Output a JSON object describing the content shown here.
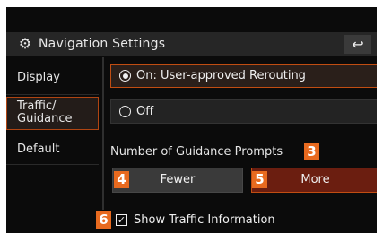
{
  "header": {
    "gear_icon": "gear-icon",
    "title": "Navigation Settings",
    "back_icon": "back-arrow-icon",
    "back_glyph": "↩"
  },
  "sidebar": {
    "items": [
      {
        "label": "Display",
        "active": false
      },
      {
        "label": "Traffic/\nGuidance",
        "active": true
      },
      {
        "label": "Default",
        "active": false
      }
    ]
  },
  "main": {
    "options": [
      {
        "label": "On: User-approved Rerouting",
        "selected": true
      },
      {
        "label": "Off",
        "selected": false
      }
    ],
    "prompts_label": "Number of Guidance Prompts",
    "buttons": {
      "fewer": "Fewer",
      "more": "More"
    },
    "show_traffic": {
      "label": "Show Traffic Information",
      "checked": true
    }
  },
  "callouts": {
    "three": "3",
    "four": "4",
    "five": "5",
    "six": "6"
  },
  "colors": {
    "accent": "#c14d12",
    "badge": "#e86a1f",
    "more_bg": "#6b1e10"
  }
}
